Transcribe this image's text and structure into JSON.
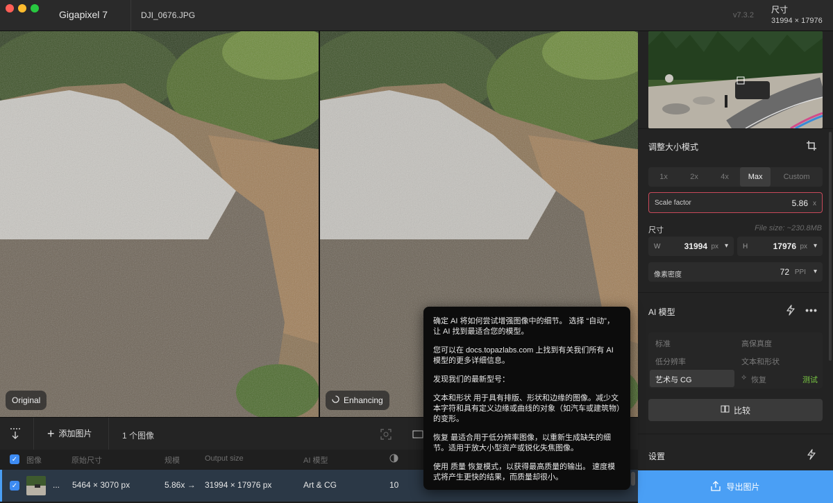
{
  "titlebar": {
    "app_name": "Gigapixel 7",
    "file_name": "DJI_0676.JPG",
    "version": "v7.3.2",
    "size_label": "尺寸",
    "size_value": "31994 × 17976"
  },
  "preview": {
    "left_label": "Original",
    "right_label": "Enhancing"
  },
  "resize": {
    "title": "调整大小模式",
    "modes": [
      "1x",
      "2x",
      "4x",
      "Max",
      "Custom"
    ],
    "active_mode": "Max",
    "scale_factor_label": "Scale factor",
    "scale_factor_value": "5.86",
    "scale_factor_unit": "x",
    "dimensions_label": "尺寸",
    "file_size": "File size: ~230.8MB",
    "width_label": "W",
    "width_value": "31994",
    "width_unit": "px",
    "height_label": "H",
    "height_value": "17976",
    "height_unit": "px",
    "ppi_label": "像素密度",
    "ppi_value": "72",
    "ppi_unit": "PPI"
  },
  "ai_model": {
    "title": "AI 模型",
    "models": {
      "standard": "标准",
      "high_fidelity": "高保真度",
      "low_res": "低分辨率",
      "text_shape": "文本和形状",
      "art_cg": "艺术与 CG",
      "recovery": "恢复",
      "test_tag": "测试"
    },
    "compare_label": "比较"
  },
  "settings": {
    "title": "设置"
  },
  "export": {
    "label": "导出图片"
  },
  "toolbar": {
    "add_image": "添加图片",
    "image_count": "1 个图像"
  },
  "table": {
    "headers": [
      "图像",
      "原始尺寸",
      "规模",
      "Output size",
      "AI 模型"
    ],
    "row": {
      "ellipsis": "...",
      "original_size": "5464 × 3070 px",
      "scale": "5.86x →",
      "output_size": "31994 × 17976 px",
      "model": "Art & CG",
      "value": "10"
    }
  },
  "tooltip": {
    "p1": "确定 AI 将如何尝试增强图像中的细节。 选择 “自动”，让 AI 找到最适合您的模型。",
    "p2": "您可以在 docs.topazlabs.com 上找到有关我们所有 AI 模型的更多详细信息。",
    "p3": "发现我们的最新型号：",
    "p4": "文本和形状 用于具有排版、形状和边缘的图像。减少文本字符和具有定义边缘或曲线的对象（如汽车或建筑物）的变形。",
    "p5": "恢复 最适合用于低分辨率图像，以重新生成缺失的细节。适用于放大小型资产或锐化失焦图像。",
    "p6": "使用 质量 恢复模式，以获得最高质量的输出。 速度模式将产生更快的结果，而质量却很小。"
  },
  "colors": {
    "accent": "#4a9ff5",
    "field_border": "#c8495a",
    "test_tag": "#7ac943"
  }
}
